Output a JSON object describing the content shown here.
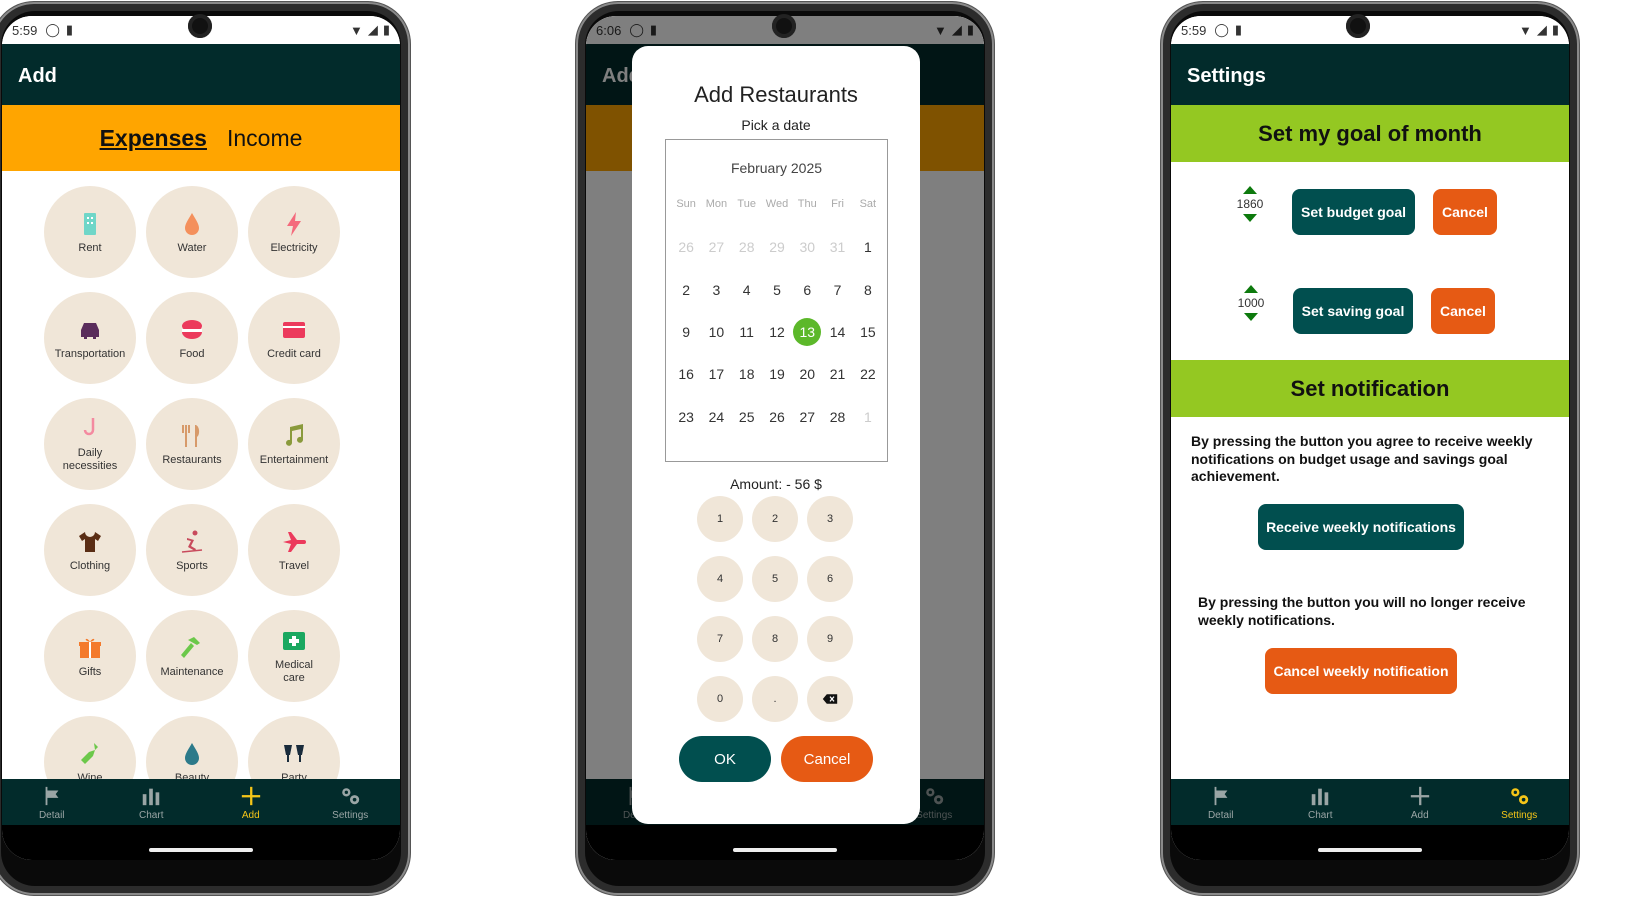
{
  "screen1": {
    "status_time": "5:59",
    "title": "Add",
    "tabs": {
      "expenses": "Expenses",
      "income": "Income"
    },
    "categories": [
      {
        "label": "Rent",
        "icon": "building-icon",
        "color": "#6fd6c8"
      },
      {
        "label": "Water",
        "icon": "water-drop-icon",
        "color": "#f4905c"
      },
      {
        "label": "Electricity",
        "icon": "lightning-icon",
        "color": "#f46a7c"
      },
      {
        "label": "Transportation",
        "icon": "car-icon",
        "color": "#5a2d5c"
      },
      {
        "label": "Food",
        "icon": "food-bowl-icon",
        "color": "#ec3a5c"
      },
      {
        "label": "Credit card",
        "icon": "credit-card-icon",
        "color": "#ec3a5c"
      },
      {
        "label": "Daily necessities",
        "icon": "hook-icon",
        "color": "#f48aa0"
      },
      {
        "label": "Restaurants",
        "icon": "fork-knife-icon",
        "color": "#d79a6a"
      },
      {
        "label": "Entertainment",
        "icon": "music-note-icon",
        "color": "#8a9a3c"
      },
      {
        "label": "Clothing",
        "icon": "tshirt-icon",
        "color": "#5a2d14"
      },
      {
        "label": "Sports",
        "icon": "skiing-icon",
        "color": "#c84a5c"
      },
      {
        "label": "Travel",
        "icon": "airplane-icon",
        "color": "#ec3a5c"
      },
      {
        "label": "Gifts",
        "icon": "gift-icon",
        "color": "#f47a2c"
      },
      {
        "label": "Maintenance",
        "icon": "hammer-icon",
        "color": "#6cc84a"
      },
      {
        "label": "Medical care",
        "icon": "first-aid-icon",
        "color": "#1aa860"
      },
      {
        "label": "Wine",
        "icon": "wine-bottle-icon",
        "color": "#6cc84a"
      },
      {
        "label": "Beauty",
        "icon": "drop-icon",
        "color": "#2c7a8a"
      },
      {
        "label": "Party",
        "icon": "cheers-icon",
        "color": "#1a2c3c"
      }
    ],
    "nav": [
      {
        "label": "Detail",
        "icon": "flag-icon"
      },
      {
        "label": "Chart",
        "icon": "bar-chart-icon"
      },
      {
        "label": "Add",
        "icon": "plus-icon"
      },
      {
        "label": "Settings",
        "icon": "gears-icon"
      }
    ]
  },
  "screen2": {
    "status_time": "6:06",
    "dialog_title": "Add Restaurants",
    "dialog_subtitle": "Pick a date",
    "month": "February 2025",
    "weekdays": [
      "Sun",
      "Mon",
      "Tue",
      "Wed",
      "Thu",
      "Fri",
      "Sat"
    ],
    "days": [
      "26",
      "27",
      "28",
      "29",
      "30",
      "31",
      "1",
      "2",
      "3",
      "4",
      "5",
      "6",
      "7",
      "8",
      "9",
      "10",
      "11",
      "12",
      "13",
      "14",
      "15",
      "16",
      "17",
      "18",
      "19",
      "20",
      "21",
      "22",
      "23",
      "24",
      "25",
      "26",
      "27",
      "28",
      "1"
    ],
    "selected_day": "13",
    "amount_label": "Amount:",
    "amount_value": "- 56 $",
    "keys": [
      "1",
      "2",
      "3",
      "4",
      "5",
      "6",
      "7",
      "8",
      "9",
      "0",
      "."
    ],
    "ok_label": "OK",
    "cancel_label": "Cancel"
  },
  "screen3": {
    "status_time": "5:59",
    "title": "Settings",
    "goal_heading": "Set my goal of month",
    "budget_value": "1860",
    "budget_button": "Set budget goal",
    "saving_value": "1000",
    "saving_button": "Set saving goal",
    "cancel_label": "Cancel",
    "notification_heading": "Set notification",
    "agree_text": "By pressing the button you agree to receive weekly notifications on budget usage and savings goal achievement.",
    "receive_button": "Receive weekly notifications",
    "no_longer_text": "By pressing the button you will no longer receive weekly notifications.",
    "cancel_notification_button": "Cancel weekly notification"
  },
  "colors": {
    "appbar": "#022b2b",
    "tabs_band": "#ffa500",
    "green_band": "#94c822",
    "teal_button": "#014f4f",
    "orange_button": "#e65a14",
    "category_bg": "#f0e6d8",
    "selected_day": "#5cb82a",
    "nav_active": "#f5c518"
  }
}
